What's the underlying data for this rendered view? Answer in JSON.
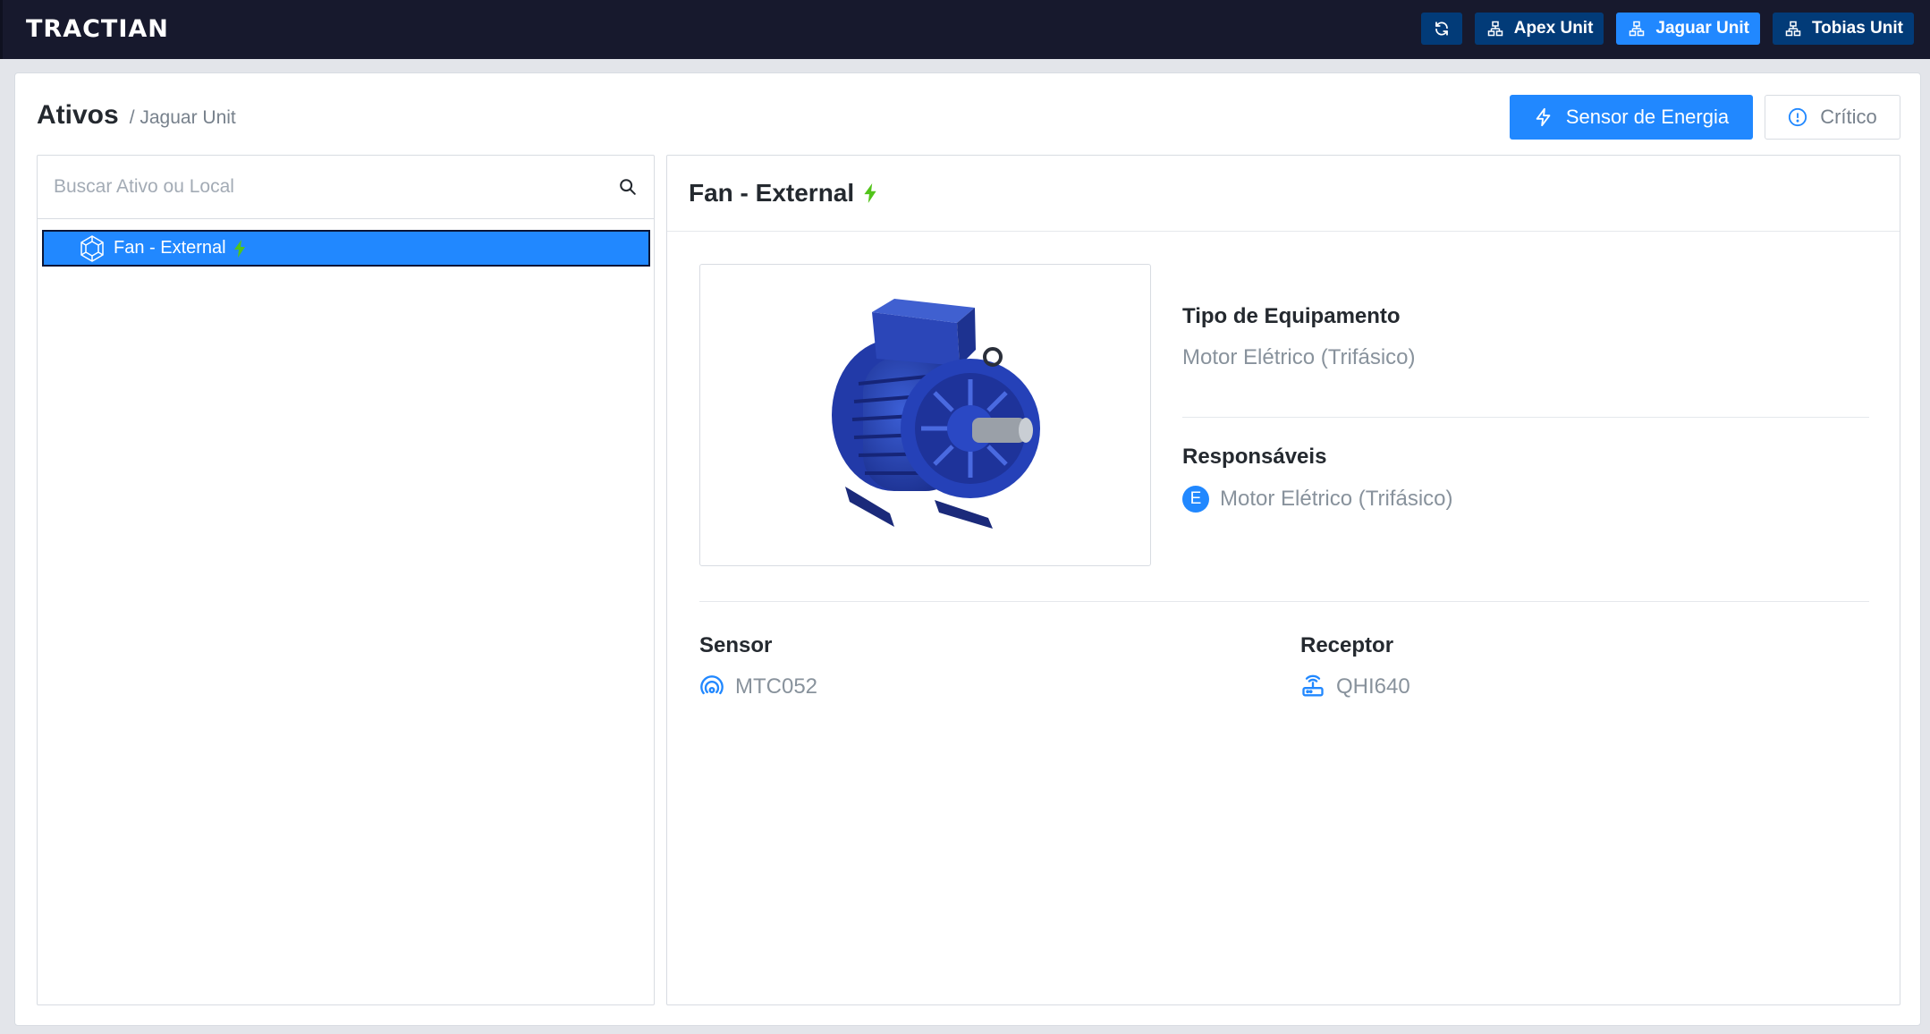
{
  "app": {
    "logo_text": "TRACTIAN"
  },
  "topbar": {
    "refresh_icon": "refresh-icon",
    "units": [
      {
        "label": "Apex Unit",
        "active": false
      },
      {
        "label": "Jaguar Unit",
        "active": true
      },
      {
        "label": "Tobias Unit",
        "active": false
      }
    ]
  },
  "header": {
    "title": "Ativos",
    "breadcrumb": "/ Jaguar Unit",
    "energy_button": "Sensor de Energia",
    "critical_button": "Crítico"
  },
  "tree": {
    "search_placeholder": "Buscar Ativo ou Local",
    "selected_item": "Fan - External"
  },
  "detail": {
    "title": "Fan - External",
    "equipment_type_label": "Tipo de Equipamento",
    "equipment_type_value": "Motor Elétrico (Trifásico)",
    "responsible_label": "Responsáveis",
    "responsible_avatar": "E",
    "responsible_value": "Motor Elétrico (Trifásico)",
    "sensor_label": "Sensor",
    "sensor_value": "MTC052",
    "receiver_label": "Receptor",
    "receiver_value": "QHI640"
  },
  "colors": {
    "topbar_bg": "#17192d",
    "unit_button_bg": "#023b78",
    "accent_blue": "#2188ff",
    "energy_green": "#52c41a",
    "text_muted": "#88929c"
  }
}
